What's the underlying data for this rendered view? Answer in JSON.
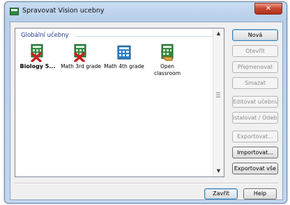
{
  "window": {
    "title": "Spravovat Vision ucebny",
    "close_label": "✕"
  },
  "list": {
    "group_label": "Globální učebny",
    "items": [
      {
        "label": "Biology 5...",
        "icon": "classroom-error-icon",
        "selected": true
      },
      {
        "label": "Math 3rd grade",
        "icon": "classroom-error-icon",
        "selected": false
      },
      {
        "label": "Math 4th grade",
        "icon": "classroom-icon",
        "selected": false
      },
      {
        "label": "Open classroom",
        "icon": "open-classroom-icon",
        "selected": false
      }
    ]
  },
  "buttons": {
    "new": "Nová",
    "open": "Otevřít",
    "rename": "Přejmenovat",
    "delete": "Smazat",
    "edit": "Editovat učebnu",
    "install": "istalovat / Odebrat",
    "export": "Exportovat...",
    "import": "Importovat...",
    "export_all": "Exportovat vše"
  },
  "footer": {
    "close": "Zavřít",
    "help": "Help"
  },
  "colors": {
    "accent": "#3c7fb1",
    "error": "#cc1f1f",
    "icon_green": "#2f8a3f",
    "icon_blue": "#2d7fc7"
  }
}
